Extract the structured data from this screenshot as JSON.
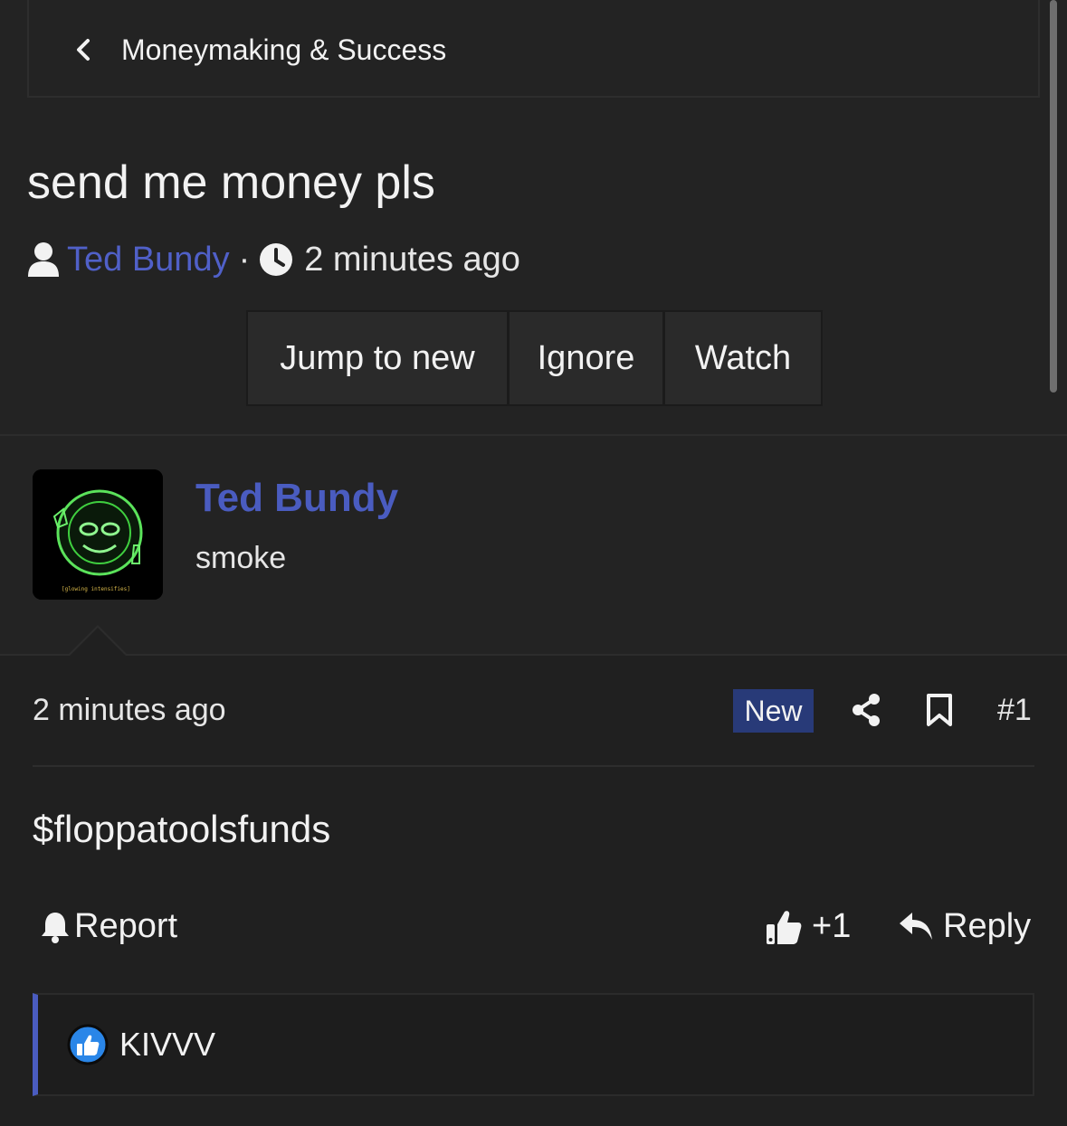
{
  "breadcrumb": {
    "label": "Moneymaking & Success",
    "icon": "chevron-left-icon"
  },
  "thread": {
    "title": "send me money pls",
    "author": "Ted Bundy",
    "separator": "·",
    "time": "2 minutes ago"
  },
  "actions": {
    "jump": "Jump to new",
    "ignore": "Ignore",
    "watch": "Watch"
  },
  "post": {
    "author": "Ted Bundy",
    "user_title": "smoke",
    "avatar_caption": "[glowing intensifies]",
    "time": "2 minutes ago",
    "badge": "New",
    "number": "#1",
    "content": "$floppatoolsfunds",
    "report_label": "Report",
    "like_label": "+1",
    "reply_label": "Reply"
  },
  "reactions": {
    "user": "KIVVV",
    "icon": "like-reaction-icon"
  },
  "colors": {
    "background": "#232323",
    "post_background": "#202020",
    "accent": "#4a5cc0",
    "badge": "#283a78"
  }
}
